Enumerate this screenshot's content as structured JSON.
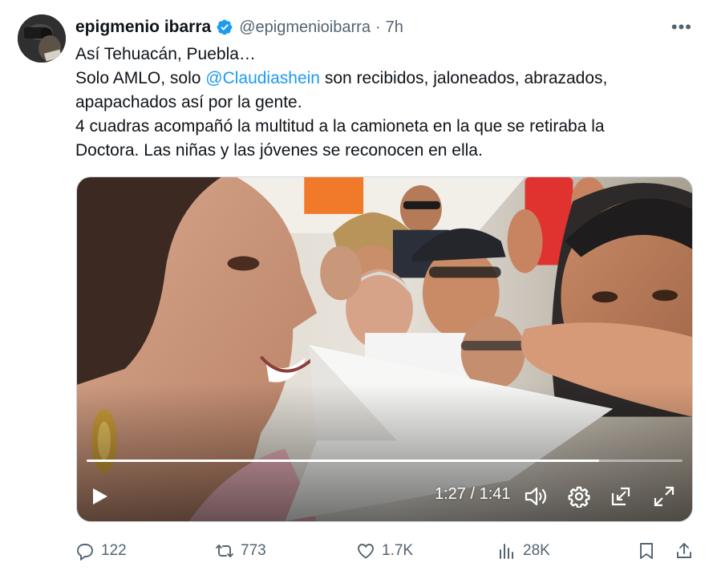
{
  "tweet": {
    "author": {
      "display_name": "epigmenio ibarra",
      "handle": "@epigmenioibarra",
      "verified": true,
      "avatar_icon": "profile-photo"
    },
    "separator": "·",
    "time": "7h",
    "more_icon": "more-horizontal-icon",
    "more_label": "•••",
    "text": {
      "line1": "Así Tehuacán, Puebla…",
      "line2_before": "Solo AMLO, solo ",
      "line2_mention": "@Claudiashein",
      "line2_after": " son recibidos, jaloneados, abrazados,",
      "line3": "apapachados así por la gente.",
      "line4": "4 cuadras acompañó la multitud a la camioneta en la que se retiraba la",
      "line5": "Doctora. Las niñas y las jóvenes se reconocen en ella."
    },
    "mention_color": "#1d9bf0"
  },
  "video": {
    "current_time": "1:27",
    "duration": "1:41",
    "time_separator": "/",
    "progress_fraction": 0.86,
    "controls": [
      "play-icon",
      "volume-icon",
      "settings-icon",
      "picture-in-picture-icon",
      "fullscreen-icon"
    ]
  },
  "actions": {
    "replies": "122",
    "reposts": "773",
    "likes": "1.7K",
    "views": "28K",
    "icons": [
      "reply-icon",
      "repost-icon",
      "like-icon",
      "views-icon",
      "bookmark-icon",
      "share-icon"
    ]
  },
  "colors": {
    "text_primary": "#0f1419",
    "text_secondary": "#536471",
    "accent": "#1d9bf0"
  }
}
